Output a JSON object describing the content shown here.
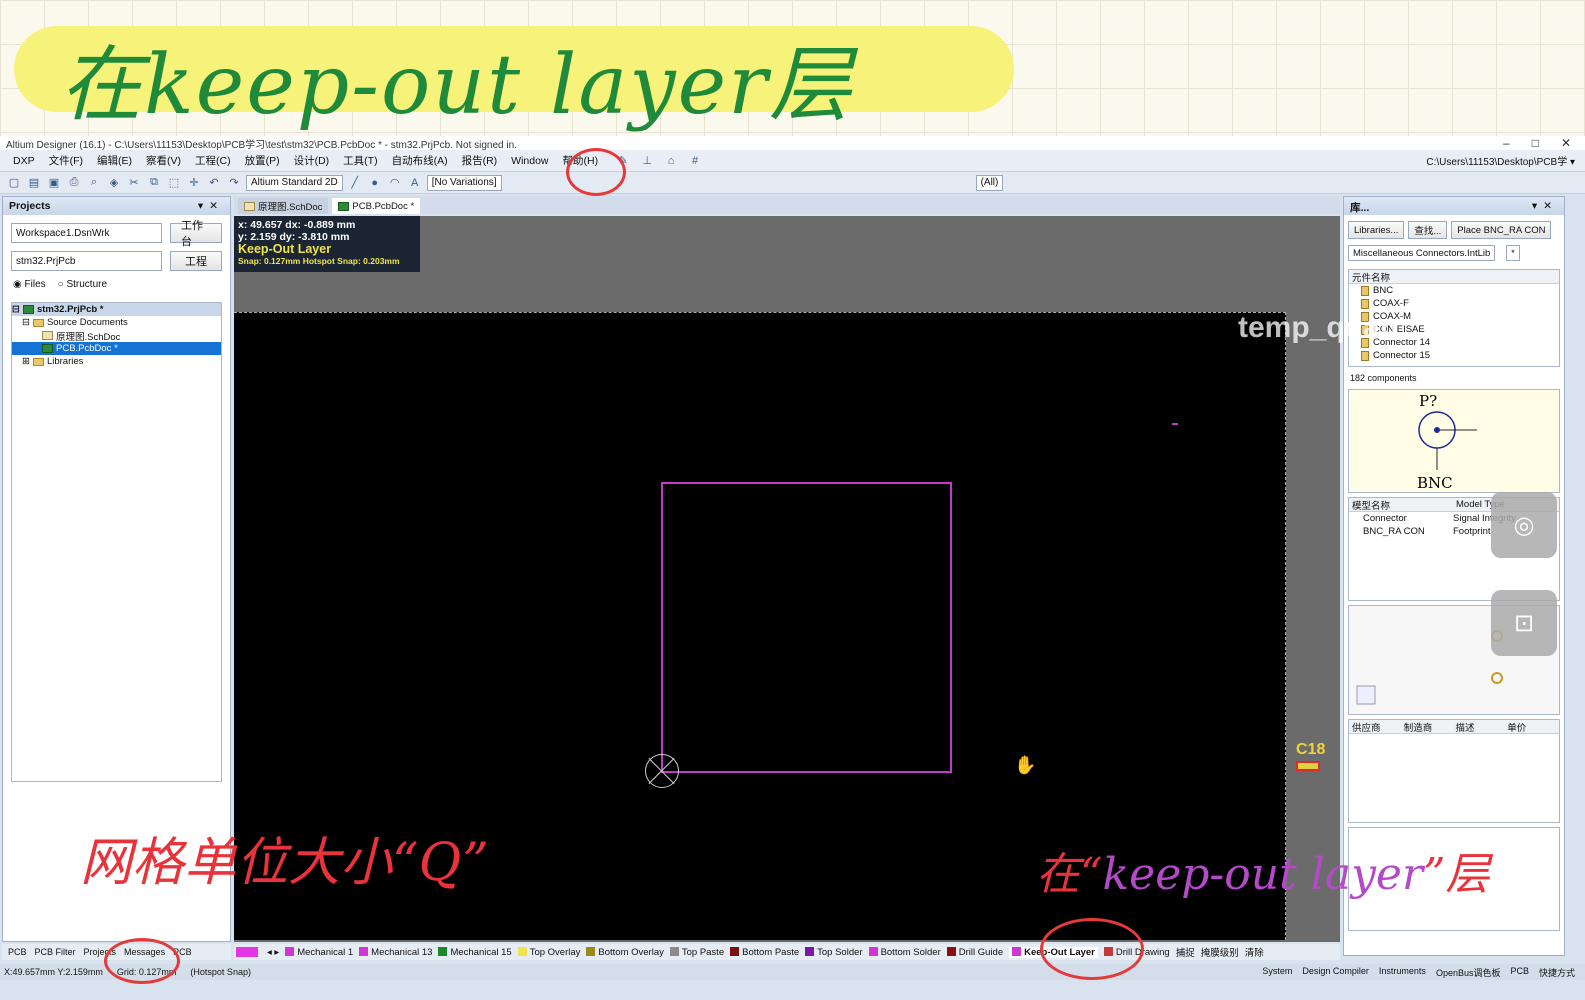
{
  "handwritten": {
    "title": "在keep-out layer层",
    "grid_note": "网格单位大小“Q”",
    "layer_note_pre": "在“",
    "layer_note_mid": "keep-out layer",
    "layer_note_post": "”层"
  },
  "window": {
    "title": "Altium Designer (16.1) - C:\\Users\\11153\\Desktop\\PCB学习\\test\\stm32\\PCB.PcbDoc * - stm32.PrjPcb. Not signed in."
  },
  "menu": {
    "items": [
      "DXP",
      "文件(F)",
      "编辑(E)",
      "察看(V)",
      "工程(C)",
      "放置(P)",
      "设计(D)",
      "工具(T)",
      "自动布线(A)",
      "报告(R)",
      "Window",
      "帮助(H)"
    ],
    "path": "C:\\Users\\11153\\Desktop\\PCB学 ▾"
  },
  "toolbar": {
    "view_combo": "Altium Standard 2D",
    "variations": "[No Variations]",
    "all_combo": "(All)"
  },
  "projects_panel": {
    "title": "Projects",
    "workspace": "Workspace1.DsnWrk",
    "workspace_btn": "工作台",
    "project": "stm32.PrjPcb",
    "project_btn": "工程",
    "files": "Files",
    "structure": "Structure",
    "tree": {
      "root": "stm32.PrjPcb *",
      "source_docs": "Source Documents",
      "sch": "原理图.SchDoc",
      "pcb": "PCB.PcbDoc *",
      "libs": "Libraries"
    }
  },
  "doc_tabs": [
    "原理图.SchDoc",
    "PCB.PcbDoc *"
  ],
  "hud": {
    "line1": "x: 49.657   dx: -0.889 mm",
    "line2": "y: 2.159    dy: -3.810 mm",
    "layer": "Keep-Out Layer",
    "snap": "Snap: 0.127mm Hotspot Snap: 0.203mm"
  },
  "designator": "C18",
  "library_panel": {
    "title": "库...",
    "btn_libraries": "Libraries...",
    "btn_search": "查找...",
    "btn_place": "Place BNC_RA CON",
    "library": "Miscellaneous Connectors.IntLib",
    "filter": "*",
    "col_name": "元件名称",
    "components": [
      "BNC",
      "COAX-F",
      "COAX-M",
      "CON EISAE",
      "Connector 14",
      "Connector 15"
    ],
    "count": "182 components",
    "preview_ref": "P?",
    "preview_name": "BNC",
    "model_col1": "模型名称",
    "model_col2": "Model Type",
    "models": [
      {
        "name": "Connector",
        "type": "Signal Integrity"
      },
      {
        "name": "BNC_RA CON",
        "type": "Footprint"
      }
    ],
    "supplier_cols": [
      "供应商",
      "制造商",
      "描述",
      "单价"
    ]
  },
  "watermark": "temp_quan",
  "layer_tabs": [
    {
      "name": "Mechanical 1",
      "color": "#d236d2"
    },
    {
      "name": "Mechanical 13",
      "color": "#d236d2"
    },
    {
      "name": "Mechanical 15",
      "color": "#1c8a2c"
    },
    {
      "name": "Top Overlay",
      "color": "#f1e44a"
    },
    {
      "name": "Bottom Overlay",
      "color": "#9a8a1a"
    },
    {
      "name": "Top Paste",
      "color": "#8a8a8a"
    },
    {
      "name": "Bottom Paste",
      "color": "#7a1010"
    },
    {
      "name": "Top Solder",
      "color": "#7a1aa0"
    },
    {
      "name": "Bottom Solder",
      "color": "#d236d2"
    },
    {
      "name": "Drill Guide",
      "color": "#8a1010"
    },
    {
      "name": "Keep-Out Layer",
      "color": "#d236d2"
    },
    {
      "name": "Drill Drawing",
      "color": "#c23a3a"
    }
  ],
  "layer_extras": [
    "捕捉",
    "掩膜级别",
    "清除"
  ],
  "left_tabs": [
    "PCB",
    "PCB Filter",
    "Projects",
    "Messages",
    "PCB"
  ],
  "status": {
    "coords": "X:49.657mm Y:2.159mm",
    "grid": "Grid: 0.127mm",
    "snap": "(Hotspot Snap)",
    "right": [
      "System",
      "Design Compiler",
      "Instruments",
      "OpenBus调色板",
      "PCB",
      "快捷方式"
    ]
  }
}
